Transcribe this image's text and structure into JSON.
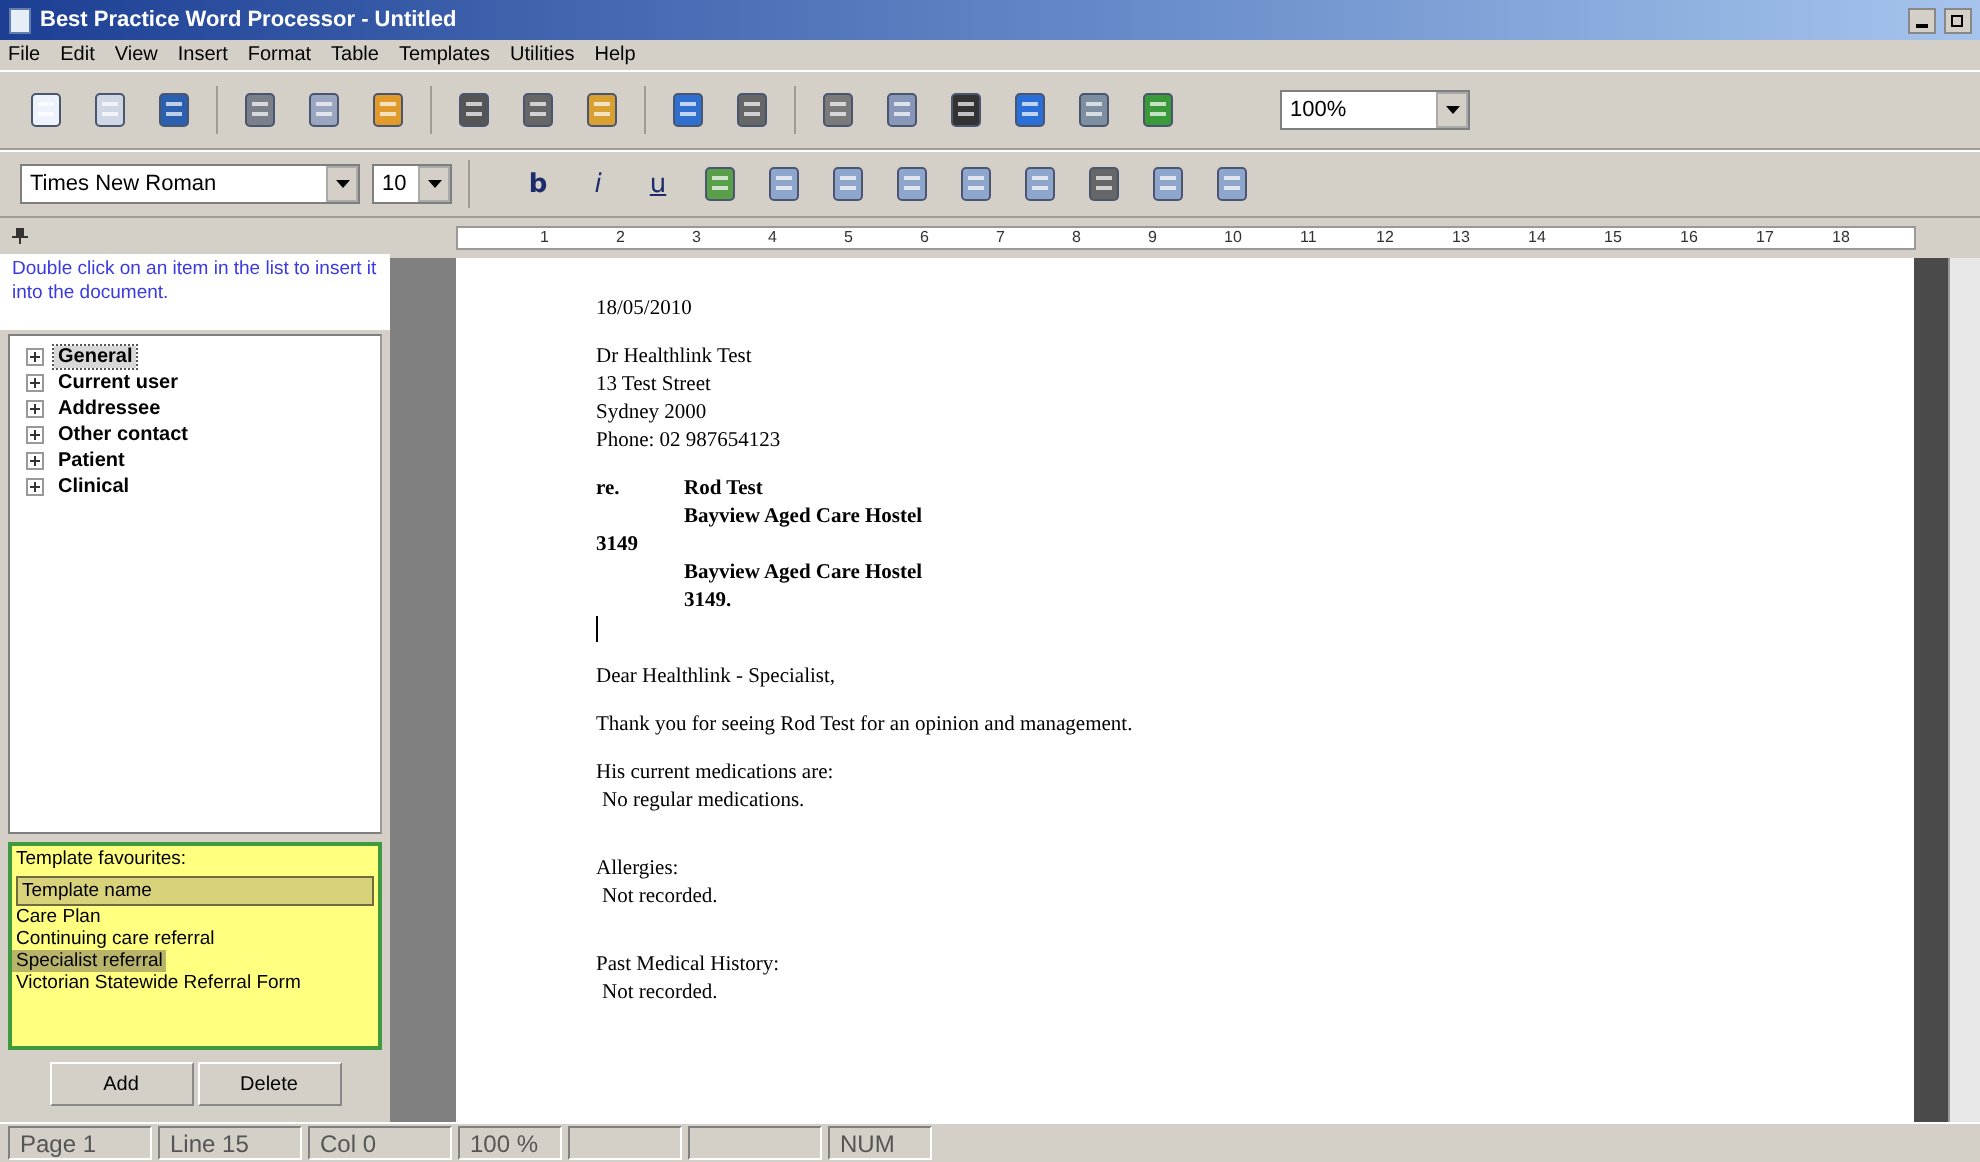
{
  "window": {
    "title": "Best Practice Word Processor - Untitled"
  },
  "menu": [
    "File",
    "Edit",
    "View",
    "Insert",
    "Format",
    "Table",
    "Templates",
    "Utilities",
    "Help"
  ],
  "toolbar": {
    "zoom": "100%",
    "font": "Times New Roman",
    "size": "10",
    "styles": [
      {
        "label": "b",
        "kind": "bold"
      },
      {
        "label": "i",
        "kind": "italic"
      },
      {
        "label": "u",
        "kind": "underline"
      }
    ]
  },
  "ruler": [
    "1",
    "2",
    "3",
    "4",
    "5",
    "6",
    "7",
    "8",
    "9",
    "10",
    "11",
    "12",
    "13",
    "14",
    "15",
    "16",
    "17",
    "18"
  ],
  "sidebar": {
    "hint": "Double click on an item in the list to insert it into the document.",
    "tree": [
      {
        "label": "General",
        "expanded": false,
        "selected": true
      },
      {
        "label": "Current user",
        "expanded": false,
        "selected": false
      },
      {
        "label": "Addressee",
        "expanded": false,
        "selected": false
      },
      {
        "label": "Other contact",
        "expanded": false,
        "selected": false
      },
      {
        "label": "Patient",
        "expanded": false,
        "selected": false
      },
      {
        "label": "Clinical",
        "expanded": false,
        "selected": false
      }
    ],
    "favourites": {
      "title": "Template favourites:",
      "column": "Template name",
      "items": [
        {
          "label": "Care Plan",
          "selected": false
        },
        {
          "label": "Continuing care referral",
          "selected": false
        },
        {
          "label": "Specialist referral",
          "selected": true
        },
        {
          "label": "Victorian Statewide Referral Form",
          "selected": false
        }
      ]
    },
    "buttons": [
      "Add",
      "Delete"
    ]
  },
  "document": [
    {
      "kind": "plain",
      "text": "18/05/2010"
    },
    {
      "kind": "gap"
    },
    {
      "kind": "plain",
      "text": "Dr Healthlink Test"
    },
    {
      "kind": "plain",
      "text": "13 Test Street"
    },
    {
      "kind": "plain",
      "text": "Sydney  2000"
    },
    {
      "kind": "plain",
      "text": "Phone: 02 987654123"
    },
    {
      "kind": "gap"
    },
    {
      "kind": "labelled",
      "label": "re.",
      "text": "Rod Test"
    },
    {
      "kind": "tabbed",
      "text": "Bayview Aged Care Hostel"
    },
    {
      "kind": "bold",
      "text": "3149"
    },
    {
      "kind": "tabbed",
      "text": "Bayview Aged Care Hostel"
    },
    {
      "kind": "tabbed",
      "text": "3149."
    },
    {
      "kind": "cursor"
    },
    {
      "kind": "gap"
    },
    {
      "kind": "plain",
      "text": "Dear Healthlink - Specialist,"
    },
    {
      "kind": "gap"
    },
    {
      "kind": "plain",
      "text": "Thank you for seeing Rod Test for an opinion and management."
    },
    {
      "kind": "gap"
    },
    {
      "kind": "plain",
      "text": "His current medications are:"
    },
    {
      "kind": "sub",
      "text": "No regular medications."
    },
    {
      "kind": "gap"
    },
    {
      "kind": "gap"
    },
    {
      "kind": "plain",
      "text": "Allergies:"
    },
    {
      "kind": "sub",
      "text": "Not recorded."
    },
    {
      "kind": "gap"
    },
    {
      "kind": "gap"
    },
    {
      "kind": "plain",
      "text": "Past Medical History:"
    },
    {
      "kind": "sub",
      "text": "Not recorded."
    }
  ],
  "status_bar": [
    "Page  1",
    "Line  15",
    "Col  0",
    "100 %",
    "NUM"
  ]
}
